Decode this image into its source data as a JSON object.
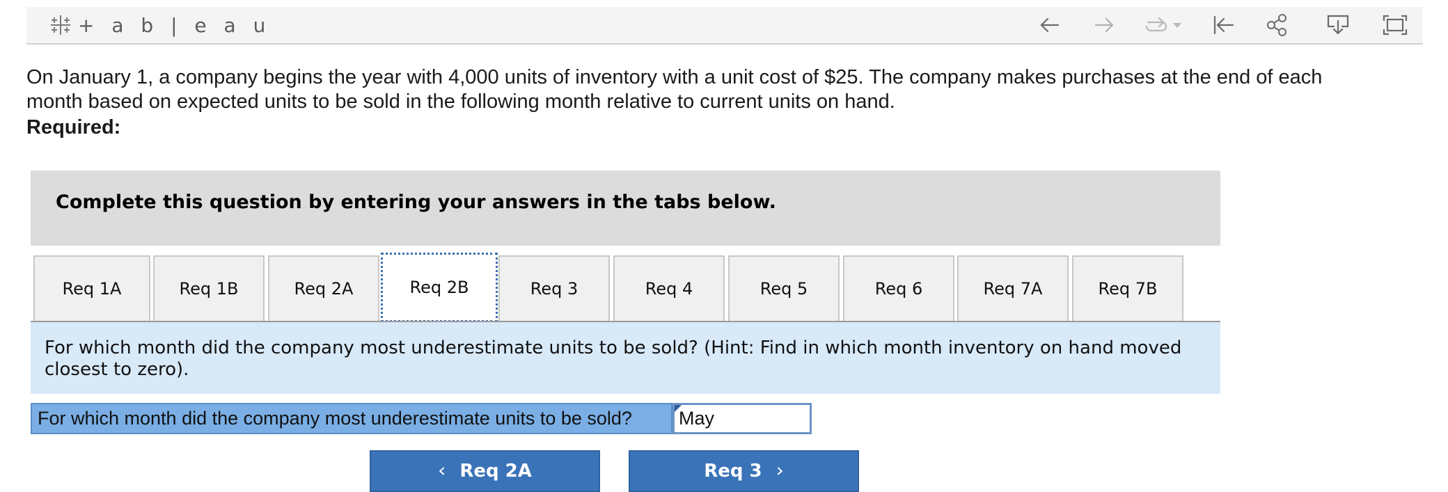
{
  "toolbar": {
    "logo_text": "+ a b | e a u",
    "icons": [
      "back-arrow-icon",
      "forward-arrow-icon",
      "redo-icon",
      "dropdown-caret-icon",
      "go-to-start-icon",
      "share-icon",
      "download-icon",
      "fullscreen-icon"
    ]
  },
  "intro": {
    "text": "On January 1, a company begins the year with 4,000 units of inventory with a unit cost of $25. The company makes purchases at the end of each month based on expected units to be sold in the following month relative to current units on hand.",
    "required_label": "Required:"
  },
  "banner": {
    "text": "Complete this question by entering your answers in the tabs below."
  },
  "tabs": [
    {
      "label": "Req 1A"
    },
    {
      "label": "Req 1B"
    },
    {
      "label": "Req 2A"
    },
    {
      "label": "Req 2B",
      "active": true
    },
    {
      "label": "Req 3"
    },
    {
      "label": "Req 4"
    },
    {
      "label": "Req 5"
    },
    {
      "label": "Req 6"
    },
    {
      "label": "Req 7A"
    },
    {
      "label": "Req 7B"
    }
  ],
  "question": {
    "text": "For which month did the company most underestimate units to be sold? (Hint: Find in which month inventory on hand moved closest to zero)."
  },
  "answer": {
    "label": "For which month did the company most underestimate units to be sold?",
    "value": "May"
  },
  "nav": {
    "prev_label": "Req 2A",
    "next_label": "Req 3"
  },
  "colors": {
    "banner_bg": "#dcdcdc",
    "question_bg": "#d8e9f8",
    "answer_label_bg": "#7aaee5",
    "nav_button_bg": "#3b73b8"
  }
}
